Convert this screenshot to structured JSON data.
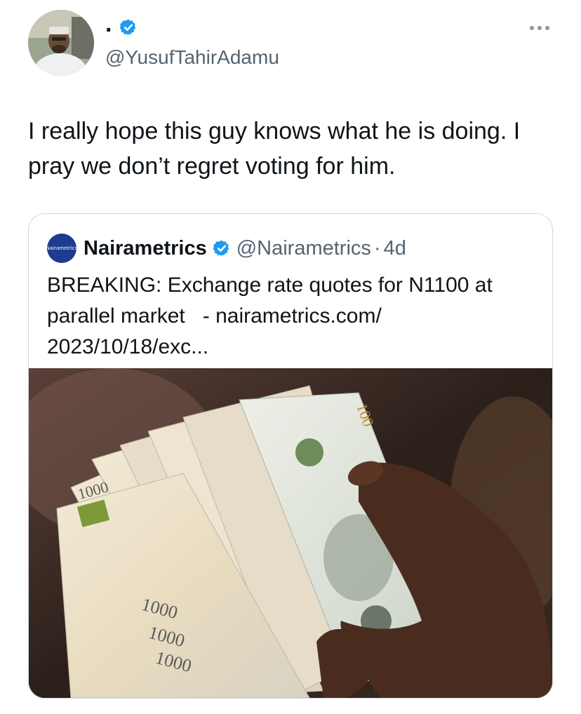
{
  "author": {
    "display_name": ".",
    "handle": "@YusufTahirAdamu",
    "verified": true
  },
  "tweet": {
    "text": "I really hope this guy knows what he is doing. I\npray we don’t regret voting for him."
  },
  "quoted": {
    "avatar_text": "Nairametrics",
    "name": "Nairametrics",
    "handle": "@Nairametrics",
    "separator": "·",
    "time": "4d",
    "text": "BREAKING: Exchange rate quotes for N1100 at\nparallel market   - nairametrics.com/\n2023/10/18/exc...",
    "image": {
      "note_value": "1000",
      "dollar_label": "100"
    }
  },
  "colors": {
    "verified": "#1d9bf0",
    "secondary_text": "#536471",
    "border": "#cfd9de"
  },
  "icons": {
    "verified": "verified-badge-icon",
    "more": "more-options-icon"
  }
}
